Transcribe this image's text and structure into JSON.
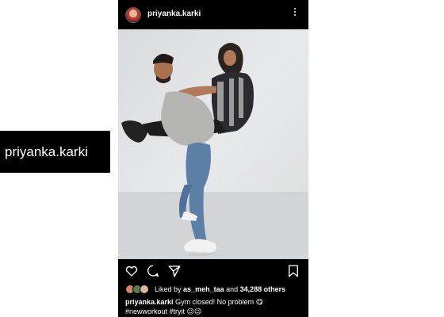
{
  "overlay": {
    "name": "priyanka.karki"
  },
  "post": {
    "username": "priyanka.karki",
    "likes": {
      "prefix": "Liked by",
      "by_user": "as_meh_taa",
      "conj": "and",
      "others": "34,288 others"
    },
    "caption": {
      "user": "priyanka.karki",
      "text": "Gym closed! No problem 😋",
      "tags": "#newworkout #tryit 😉😉"
    }
  },
  "icons": {
    "like": "heart-icon",
    "comment": "comment-icon",
    "share": "send-icon",
    "save": "bookmark-icon",
    "more": "more-vertical-icon"
  },
  "colors": {
    "app_bg": "#000000",
    "text": "#ffffff",
    "photo_bg": "#e4e4e4"
  }
}
